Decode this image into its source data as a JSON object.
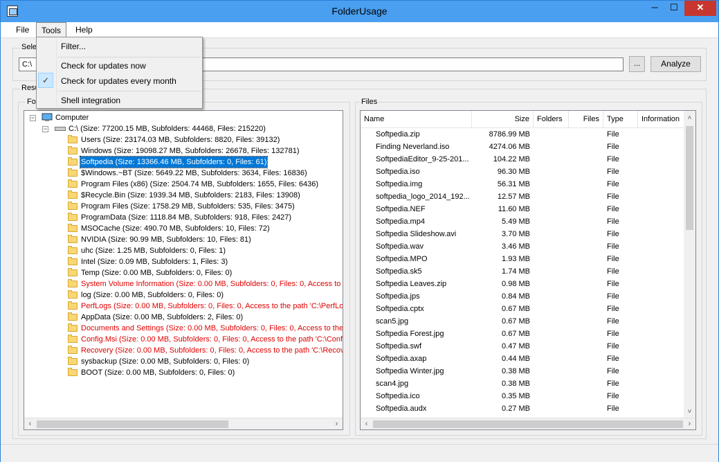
{
  "window": {
    "title": "FolderUsage",
    "min_glyph": "─",
    "max_glyph": "☐",
    "close_glyph": "✕"
  },
  "menu": {
    "file": "File",
    "tools": "Tools",
    "help": "Help"
  },
  "tools_menu": {
    "filter": "Filter...",
    "check_now": "Check for updates now",
    "check_monthly": "Check for updates every month",
    "check_monthly_checked": true,
    "check_glyph": "✓",
    "shell": "Shell integration"
  },
  "select_group": {
    "label": "Sele"
  },
  "path": {
    "value": "C:\\",
    "browse_label": "...",
    "analyze_label": "Analyze"
  },
  "results": {
    "label": "Resu",
    "folders_label": "Fol",
    "files_label": "Files"
  },
  "tree": {
    "expanded_glyph": "−",
    "root": "Computer",
    "drive": "C:\\ (Size: 77200.15 MB, Subfolders: 44468, Files: 215220)",
    "items": [
      {
        "label": "Users (Size: 23174.03 MB, Subfolders: 8820, Files: 39132)",
        "error": false,
        "selected": false
      },
      {
        "label": "Windows (Size: 19098.27 MB, Subfolders: 26678, Files: 132781)",
        "error": false,
        "selected": false
      },
      {
        "label": "Softpedia (Size: 13366.46 MB, Subfolders: 0, Files: 61)",
        "error": false,
        "selected": true
      },
      {
        "label": "$Windows.~BT (Size: 5649.22 MB, Subfolders: 3634, Files: 16836)",
        "error": false,
        "selected": false
      },
      {
        "label": "Program Files (x86) (Size: 2504.74 MB, Subfolders: 1655, Files: 6436)",
        "error": false,
        "selected": false
      },
      {
        "label": "$Recycle.Bin (Size: 1939.34 MB, Subfolders: 2183, Files: 13908)",
        "error": false,
        "selected": false
      },
      {
        "label": "Program Files (Size: 1758.29 MB, Subfolders: 535, Files: 3475)",
        "error": false,
        "selected": false
      },
      {
        "label": "ProgramData (Size: 1118.84 MB, Subfolders: 918, Files: 2427)",
        "error": false,
        "selected": false
      },
      {
        "label": "MSOCache (Size: 490.70 MB, Subfolders: 10, Files: 72)",
        "error": false,
        "selected": false
      },
      {
        "label": "NVIDIA (Size: 90.99 MB, Subfolders: 10, Files: 81)",
        "error": false,
        "selected": false
      },
      {
        "label": "uhc (Size: 1.25 MB, Subfolders: 0, Files: 1)",
        "error": false,
        "selected": false
      },
      {
        "label": "Intel (Size: 0.09 MB, Subfolders: 1, Files: 3)",
        "error": false,
        "selected": false
      },
      {
        "label": "Temp (Size: 0.00 MB, Subfolders: 0, Files: 0)",
        "error": false,
        "selected": false
      },
      {
        "label": "System Volume Information (Size: 0.00 MB, Subfolders: 0, Files: 0, Access to t",
        "error": true,
        "selected": false
      },
      {
        "label": "log (Size: 0.00 MB, Subfolders: 0, Files: 0)",
        "error": false,
        "selected": false
      },
      {
        "label": "PerfLogs (Size: 0.00 MB, Subfolders: 0, Files: 0, Access to the path 'C:\\PerfLo",
        "error": true,
        "selected": false
      },
      {
        "label": "AppData (Size: 0.00 MB, Subfolders: 2, Files: 0)",
        "error": false,
        "selected": false
      },
      {
        "label": "Documents and Settings (Size: 0.00 MB, Subfolders: 0, Files: 0, Access to the",
        "error": true,
        "selected": false
      },
      {
        "label": "Config.Msi (Size: 0.00 MB, Subfolders: 0, Files: 0, Access to the path 'C:\\Config",
        "error": true,
        "selected": false
      },
      {
        "label": "Recovery (Size: 0.00 MB, Subfolders: 0, Files: 0, Access to the path 'C:\\Recove",
        "error": true,
        "selected": false
      },
      {
        "label": "sysbackup (Size: 0.00 MB, Subfolders: 0, Files: 0)",
        "error": false,
        "selected": false
      },
      {
        "label": "BOOT (Size: 0.00 MB, Subfolders: 0, Files: 0)",
        "error": false,
        "selected": false
      }
    ]
  },
  "files": {
    "columns": [
      "Name",
      "Size",
      "Folders",
      "Files",
      "Type",
      "Information"
    ],
    "rows": [
      {
        "name": "Softpedia.zip",
        "size": "8786.99 MB",
        "type": "File"
      },
      {
        "name": "Finding Neverland.iso",
        "size": "4274.06 MB",
        "type": "File"
      },
      {
        "name": "SoftpediaEditor_9-25-201...",
        "size": "104.22 MB",
        "type": "File"
      },
      {
        "name": "Softpedia.iso",
        "size": "96.30 MB",
        "type": "File"
      },
      {
        "name": "Softpedia.img",
        "size": "56.31 MB",
        "type": "File"
      },
      {
        "name": "softpedia_logo_2014_192...",
        "size": "12.57 MB",
        "type": "File"
      },
      {
        "name": "Softpedia.NEF",
        "size": "11.60 MB",
        "type": "File"
      },
      {
        "name": "Softpedia.mp4",
        "size": "5.49 MB",
        "type": "File"
      },
      {
        "name": "Softpedia Slideshow.avi",
        "size": "3.70 MB",
        "type": "File"
      },
      {
        "name": "Softpedia.wav",
        "size": "3.46 MB",
        "type": "File"
      },
      {
        "name": "Softpedia.MPO",
        "size": "1.93 MB",
        "type": "File"
      },
      {
        "name": "Softpedia.sk5",
        "size": "1.74 MB",
        "type": "File"
      },
      {
        "name": "Softpedia Leaves.zip",
        "size": "0.98 MB",
        "type": "File"
      },
      {
        "name": "Softpedia.jps",
        "size": "0.84 MB",
        "type": "File"
      },
      {
        "name": "Softpedia.cptx",
        "size": "0.67 MB",
        "type": "File"
      },
      {
        "name": "scan5.jpg",
        "size": "0.67 MB",
        "type": "File"
      },
      {
        "name": "Softpedia Forest.jpg",
        "size": "0.67 MB",
        "type": "File"
      },
      {
        "name": "Softpedia.swf",
        "size": "0.47 MB",
        "type": "File"
      },
      {
        "name": "Softpedia.axap",
        "size": "0.44 MB",
        "type": "File"
      },
      {
        "name": "Softpedia Winter.jpg",
        "size": "0.38 MB",
        "type": "File"
      },
      {
        "name": "scan4.jpg",
        "size": "0.38 MB",
        "type": "File"
      },
      {
        "name": "Softpedia.ico",
        "size": "0.35 MB",
        "type": "File"
      },
      {
        "name": "Softpedia.audx",
        "size": "0.27 MB",
        "type": "File"
      }
    ]
  },
  "scroll": {
    "left": "‹",
    "right": "›",
    "up": "˄",
    "down": "˅"
  },
  "colors": {
    "error_text": "#e00000",
    "selection": "#0078d7",
    "folder": "#f8d775",
    "titlebar": "#4a9ff0",
    "close": "#c7372f"
  }
}
